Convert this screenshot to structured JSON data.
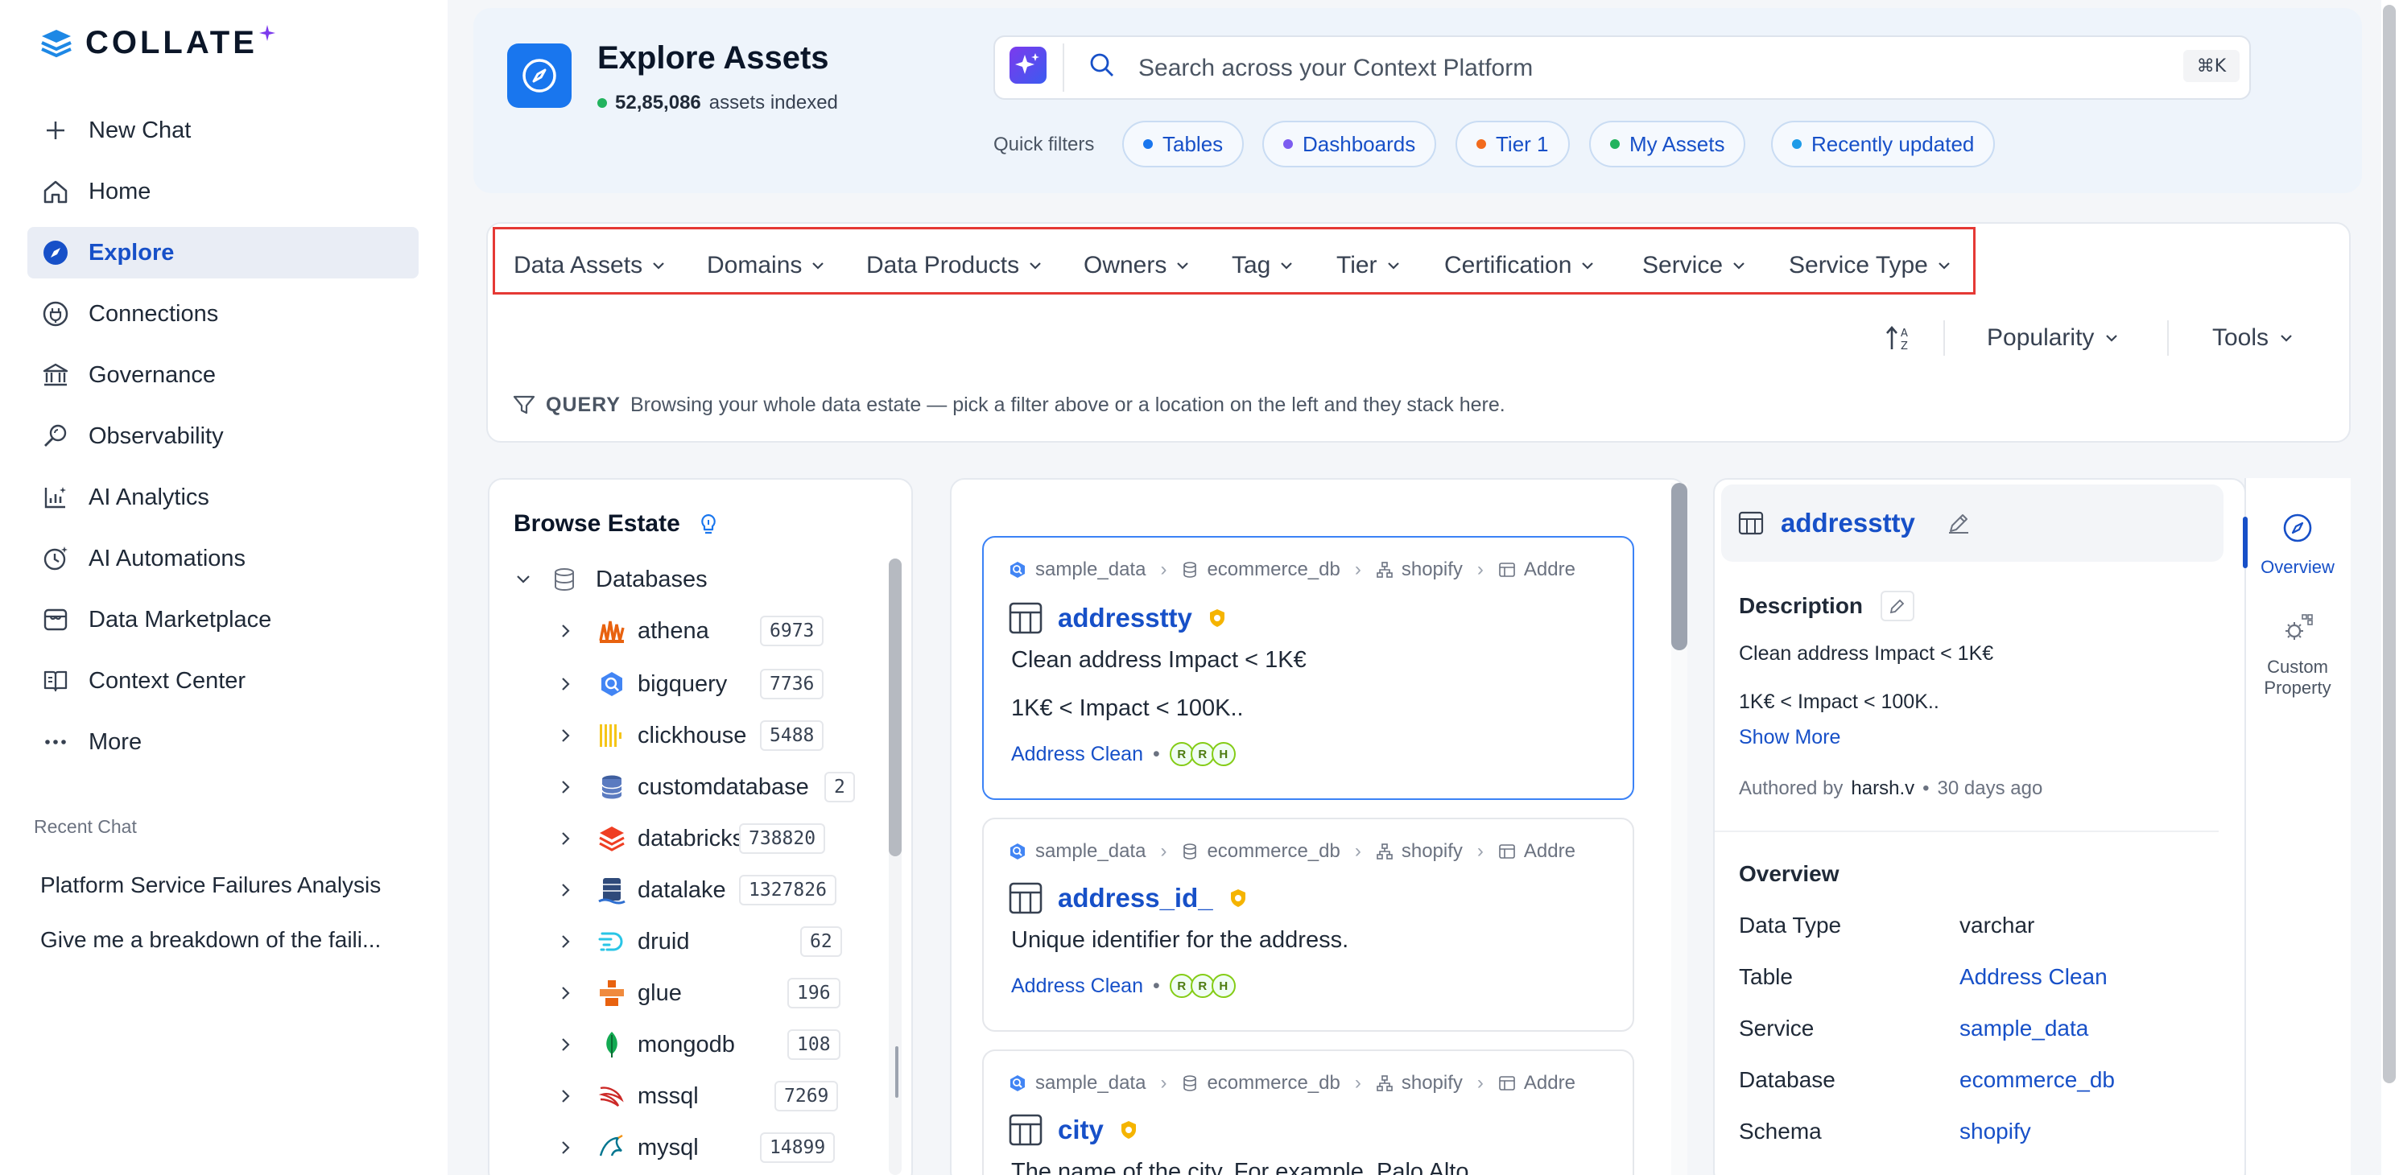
{
  "app": {
    "logo_text": "COLLATE"
  },
  "sidebar": {
    "items": [
      {
        "label": "New Chat",
        "icon": "plus-icon"
      },
      {
        "label": "Home",
        "icon": "home-icon"
      },
      {
        "label": "Explore",
        "icon": "compass-icon",
        "active": true
      },
      {
        "label": "Connections",
        "icon": "plug-icon"
      },
      {
        "label": "Governance",
        "icon": "bank-icon"
      },
      {
        "label": "Observability",
        "icon": "telescope-icon"
      },
      {
        "label": "AI Analytics",
        "icon": "chart-icon"
      },
      {
        "label": "AI Automations",
        "icon": "clock-spark-icon"
      },
      {
        "label": "Data Marketplace",
        "icon": "store-icon"
      },
      {
        "label": "Context Center",
        "icon": "book-icon"
      },
      {
        "label": "More",
        "icon": "ellipsis-icon"
      }
    ],
    "recent_label": "Recent Chat",
    "recent_chats": [
      "Platform Service Failures Analysis",
      "Give me a breakdown of the faili..."
    ]
  },
  "header": {
    "title": "Explore Assets",
    "count": "52,85,086",
    "count_suffix": "assets indexed",
    "search_placeholder": "Search across your Context Platform",
    "shortcut": "⌘K",
    "quick_filters_label": "Quick filters",
    "quick_filters": [
      {
        "label": "Tables",
        "color": "#1976ee"
      },
      {
        "label": "Dashboards",
        "color": "#7c5cf0"
      },
      {
        "label": "Tier 1",
        "color": "#f26b1d"
      },
      {
        "label": "My Assets",
        "color": "#22b35e"
      },
      {
        "label": "Recently updated",
        "color": "#1e9be8"
      }
    ]
  },
  "filters": {
    "dropdowns": [
      "Data Assets",
      "Domains",
      "Data Products",
      "Owners",
      "Tag",
      "Tier",
      "Certification",
      "Service",
      "Service Type"
    ],
    "sort_by": "Popularity",
    "tools": "Tools",
    "query_label": "QUERY",
    "query_text": "Browsing your whole data estate — pick a filter above or a location on the left and they stack here."
  },
  "browse": {
    "title": "Browse Estate",
    "root": "Databases",
    "items": [
      {
        "name": "athena",
        "count": "6973",
        "icon": "athena-icon",
        "color": "#e8620f"
      },
      {
        "name": "bigquery",
        "count": "7736",
        "icon": "bigquery-icon",
        "color": "#4285f4"
      },
      {
        "name": "clickhouse",
        "count": "5488",
        "icon": "clickhouse-icon",
        "color": "#f5c518"
      },
      {
        "name": "customdatabase",
        "count": "2",
        "icon": "customdatabase-icon",
        "color": "#3f5f9f"
      },
      {
        "name": "databricks",
        "count": "738820",
        "icon": "databricks-icon",
        "color": "#ef3e23"
      },
      {
        "name": "datalake",
        "count": "1327826",
        "icon": "datalake-icon",
        "color": "#2f4a7a"
      },
      {
        "name": "druid",
        "count": "62",
        "icon": "druid-icon",
        "color": "#29c5e6"
      },
      {
        "name": "glue",
        "count": "196",
        "icon": "glue-icon",
        "color": "#e8620f"
      },
      {
        "name": "mongodb",
        "count": "108",
        "icon": "mongodb-icon",
        "color": "#13aa52"
      },
      {
        "name": "mssql",
        "count": "7269",
        "icon": "mssql-icon",
        "color": "#cc2927"
      },
      {
        "name": "mysql",
        "count": "14899",
        "icon": "mysql-icon",
        "color": "#00758f"
      }
    ]
  },
  "results": [
    {
      "breadcrumb": [
        "sample_data",
        "ecommerce_db",
        "shopify",
        "Addre"
      ],
      "title": "addresstty",
      "desc": "Clean address Impact < 1K€",
      "desc2": "1K€ < Impact < 100K..",
      "table_link": "Address Clean",
      "owners": [
        "R",
        "R",
        "H"
      ]
    },
    {
      "breadcrumb": [
        "sample_data",
        "ecommerce_db",
        "shopify",
        "Addre"
      ],
      "title": "address_id_",
      "desc": "Unique identifier for the address.",
      "table_link": "Address Clean",
      "owners": [
        "R",
        "R",
        "H"
      ]
    },
    {
      "breadcrumb": [
        "sample_data",
        "ecommerce_db",
        "shopify",
        "Addre"
      ],
      "title": "city",
      "desc": "The name of the city. For example, Palo Alto."
    }
  ],
  "detail": {
    "title": "addresstty",
    "description_label": "Description",
    "description": "Clean address Impact < 1K€",
    "description2": "1K€ < Impact < 100K..",
    "show_more": "Show More",
    "authored_by": "Authored by",
    "author": "harsh.v",
    "time": "30 days ago",
    "overview_label": "Overview",
    "rows": [
      {
        "key": "Data Type",
        "value": "varchar",
        "link": false
      },
      {
        "key": "Table",
        "value": "Address Clean",
        "link": true
      },
      {
        "key": "Service",
        "value": "sample_data",
        "link": true
      },
      {
        "key": "Database",
        "value": "ecommerce_db",
        "link": true
      },
      {
        "key": "Schema",
        "value": "shopify",
        "link": true
      }
    ]
  },
  "rail": {
    "overview": "Overview",
    "custom_property": "Custom Property"
  },
  "colors": {
    "accent": "#1750c8",
    "brand": "#1976ee",
    "highlight_border": "#e53935"
  }
}
